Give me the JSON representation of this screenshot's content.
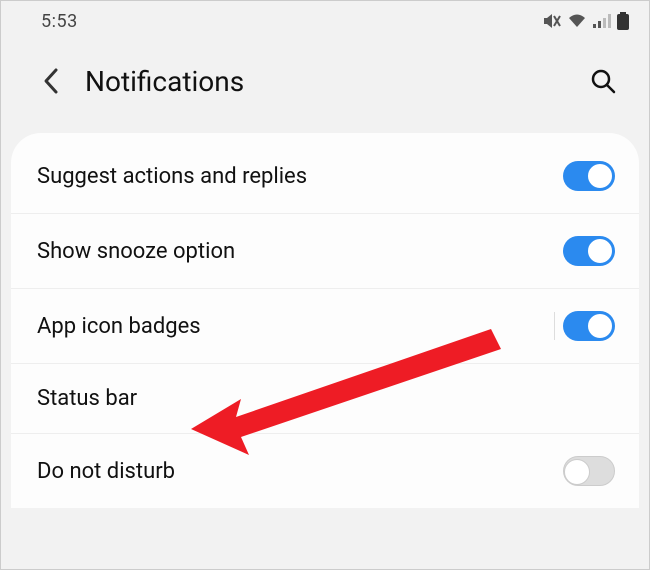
{
  "status_bar": {
    "time": "5:53"
  },
  "header": {
    "title": "Notifications"
  },
  "rows": [
    {
      "label": "Suggest actions and replies"
    },
    {
      "label": "Show snooze option"
    },
    {
      "label": "App icon badges"
    },
    {
      "label": "Status bar"
    },
    {
      "label": "Do not disturb"
    }
  ]
}
